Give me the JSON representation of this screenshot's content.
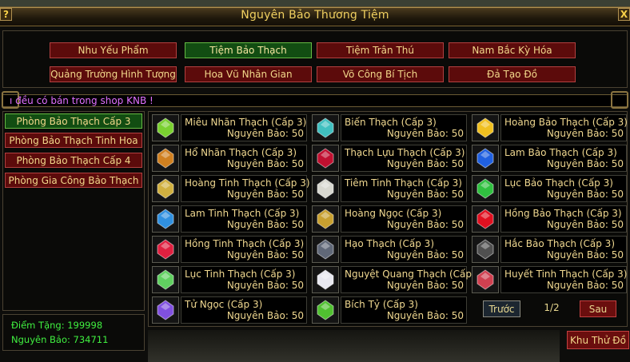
{
  "window": {
    "title": "Nguyên Bảo Thương Tiệm",
    "help_label": "?",
    "close_label": "X"
  },
  "tabs": [
    {
      "label": "Nhu Yếu Phẩm",
      "active": false
    },
    {
      "label": "Tiệm Bảo Thạch",
      "active": true
    },
    {
      "label": "Tiệm Trân Thú",
      "active": false
    },
    {
      "label": "Nam Bắc Kỳ Hóa",
      "active": false
    },
    {
      "label": "Quảng Trường Hình Tượng",
      "active": false
    },
    {
      "label": "Hoa Vũ Nhân Gian",
      "active": false
    },
    {
      "label": "Võ Công Bí Tịch",
      "active": false
    },
    {
      "label": "Đả Tạo Đồ",
      "active": false
    }
  ],
  "marquee": {
    "text": "ı đều có bán trong shop KNB !"
  },
  "categories": [
    {
      "label": "Phòng Bảo Thạch Cấp 3",
      "active": true
    },
    {
      "label": "Phòng Bảo Thạch Tinh Hoa",
      "active": false
    },
    {
      "label": "Phòng Bảo Thạch Cấp 4",
      "active": false
    },
    {
      "label": "Phòng Gia Công Bảo Thạch",
      "active": false
    }
  ],
  "stats": {
    "points": "Điểm Tặng: 199998",
    "yuanbao": "Nguyên Bảo: 734711"
  },
  "items": [
    {
      "name": "Miêu Nhãn Thạch (Cấp 3)",
      "price": "Nguyên Bảo: 50",
      "icon": "gem-green-icon",
      "color": "#7ad030"
    },
    {
      "name": "Biến Thạch (Cấp 3)",
      "price": "Nguyên Bảo: 50",
      "icon": "gem-cyan-red-icon",
      "color": "#40c0c0"
    },
    {
      "name": "Hoàng Bảo Thạch (Cấp 3)",
      "price": "Nguyên Bảo: 50",
      "icon": "gem-yellow-icon",
      "color": "#f0c020"
    },
    {
      "name": "Hổ Nhãn Thạch (Cấp 3)",
      "price": "Nguyên Bảo: 50",
      "icon": "gem-amber-icon",
      "color": "#d08020"
    },
    {
      "name": "Thạch Lựu Thạch (Cấp 3)",
      "price": "Nguyên Bảo: 50",
      "icon": "gem-crimson-icon",
      "color": "#c01030"
    },
    {
      "name": "Lam Bảo Thạch (Cấp 3)",
      "price": "Nguyên Bảo: 50",
      "icon": "gem-blue-icon",
      "color": "#2060e0"
    },
    {
      "name": "Hoàng Tinh Thạch (Cấp 3)",
      "price": "Nguyên Bảo: 50",
      "icon": "gem-citrine-icon",
      "color": "#d0b040"
    },
    {
      "name": "Tiêm Tinh Thạch (Cấp 3)",
      "price": "Nguyên Bảo: 50",
      "icon": "gem-white-icon",
      "color": "#d8d8d0"
    },
    {
      "name": "Lục Bảo Thạch (Cấp 3)",
      "price": "Nguyên Bảo: 50",
      "icon": "gem-emerald-icon",
      "color": "#30c040"
    },
    {
      "name": "Lam Tinh Thạch (Cấp 3)",
      "price": "Nguyên Bảo: 50",
      "icon": "gem-sapphire-icon",
      "color": "#3090e0"
    },
    {
      "name": "Hoàng Ngọc (Cấp 3)",
      "price": "Nguyên Bảo: 50",
      "icon": "jade-yellow-icon",
      "color": "#c8a030"
    },
    {
      "name": "Hồng Bảo Thạch (Cấp 3)",
      "price": "Nguyên Bảo: 50",
      "icon": "gem-ruby-icon",
      "color": "#e01020"
    },
    {
      "name": "Hồng Tinh Thạch (Cấp 3)",
      "price": "Nguyên Bảo: 50",
      "icon": "gem-pink-icon",
      "color": "#e02040"
    },
    {
      "name": "Hạo Thạch (Cấp 3)",
      "price": "Nguyên Bảo: 50",
      "icon": "gem-dark-icon",
      "color": "#606878"
    },
    {
      "name": "Hắc Bảo Thạch (Cấp 3)",
      "price": "Nguyên Bảo: 50",
      "icon": "gem-black-icon",
      "color": "#505050"
    },
    {
      "name": "Lục Tinh Thạch (Cấp 3)",
      "price": "Nguyên Bảo: 50",
      "icon": "gem-peridot-icon",
      "color": "#60d060"
    },
    {
      "name": "Nguyệt Quang Thạch (Cấp 3)",
      "price": "Nguyên Bảo: 50",
      "icon": "gem-moonstone-icon",
      "color": "#e8e8f0"
    },
    {
      "name": "Huyết Tinh Thạch (Cấp 3)",
      "price": "Nguyên Bảo: 50",
      "icon": "gem-blood-icon",
      "color": "#d04050"
    },
    {
      "name": "Tử Ngọc (Cấp 3)",
      "price": "Nguyên Bảo: 50",
      "icon": "gem-purple-icon",
      "color": "#8050e0"
    },
    {
      "name": "Bích Tỷ (Cấp 3)",
      "price": "Nguyên Bảo: 50",
      "icon": "gem-jade-green-icon",
      "color": "#50c030"
    }
  ],
  "pagination": {
    "prev_label": "Trước",
    "page": "1/2",
    "next_label": "Sau"
  },
  "storage_button": "Khu Thử Đồ"
}
